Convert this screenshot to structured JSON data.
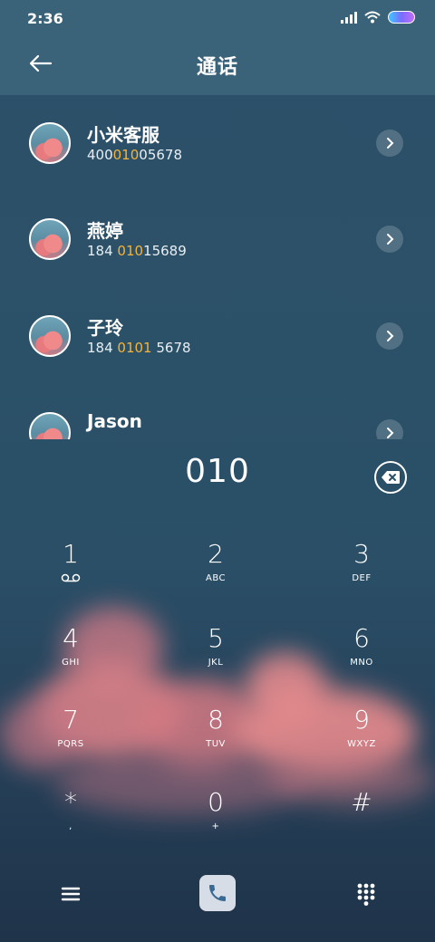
{
  "status_bar": {
    "time": "2:36"
  },
  "header": {
    "title": "通话"
  },
  "contacts": [
    {
      "name": "小米客服",
      "number_parts": [
        "400",
        "010",
        "05678"
      ]
    },
    {
      "name": "燕婷",
      "number_parts": [
        "184 ",
        "010",
        "15689"
      ]
    },
    {
      "name": "子玲",
      "number_parts": [
        "184 ",
        "0101",
        " 5678"
      ]
    },
    {
      "name": "Jason",
      "number_parts": [
        "",
        "",
        ""
      ]
    }
  ],
  "dialer": {
    "input": "010"
  },
  "keypad": [
    {
      "digit": "1",
      "letters": ""
    },
    {
      "digit": "2",
      "letters": "ABC"
    },
    {
      "digit": "3",
      "letters": "DEF"
    },
    {
      "digit": "4",
      "letters": "GHI"
    },
    {
      "digit": "5",
      "letters": "JKL"
    },
    {
      "digit": "6",
      "letters": "MNO"
    },
    {
      "digit": "7",
      "letters": "PQRS"
    },
    {
      "digit": "8",
      "letters": "TUV"
    },
    {
      "digit": "9",
      "letters": "WXYZ"
    },
    {
      "digit": "*",
      "letters": ","
    },
    {
      "digit": "0",
      "letters": "+"
    },
    {
      "digit": "#",
      "letters": ""
    }
  ],
  "icons": {
    "back": "back-arrow-icon",
    "chevron": "chevron-right-icon",
    "delete": "backspace-icon",
    "voicemail": "voicemail-icon",
    "menu": "menu-icon",
    "call": "phone-icon",
    "dialpad": "dialpad-icon"
  },
  "colors": {
    "highlight": "#f4b33a",
    "header_bg": "#3a6379",
    "background": "#2b5168"
  }
}
